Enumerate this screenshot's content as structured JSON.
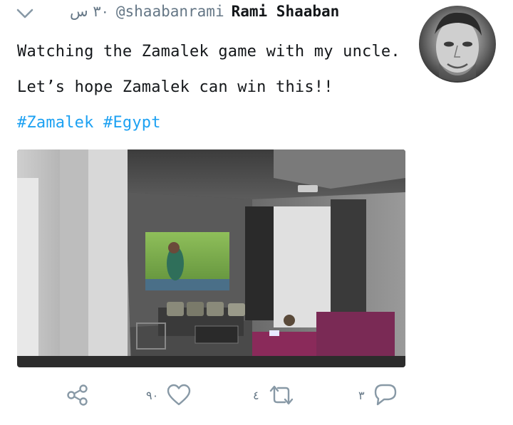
{
  "tweet": {
    "time": "٣٠ س",
    "handle": "@shaabanrami",
    "name": "Rami Shaaban",
    "text_main": "Watching the Zamalek game with my uncle. Let’s hope Zamalek can win this!!",
    "hashtag1": "#Zamalek",
    "hashtag2": "#Egypt"
  },
  "actions": {
    "likes": "٩٠",
    "retweets": "٤",
    "replies": "٣"
  },
  "colors": {
    "link": "#1da1f2",
    "muted": "#657786",
    "text": "#14171a"
  },
  "icons": [
    "chevron-down-icon",
    "share-icon",
    "heart-icon",
    "retweet-icon",
    "reply-icon"
  ]
}
